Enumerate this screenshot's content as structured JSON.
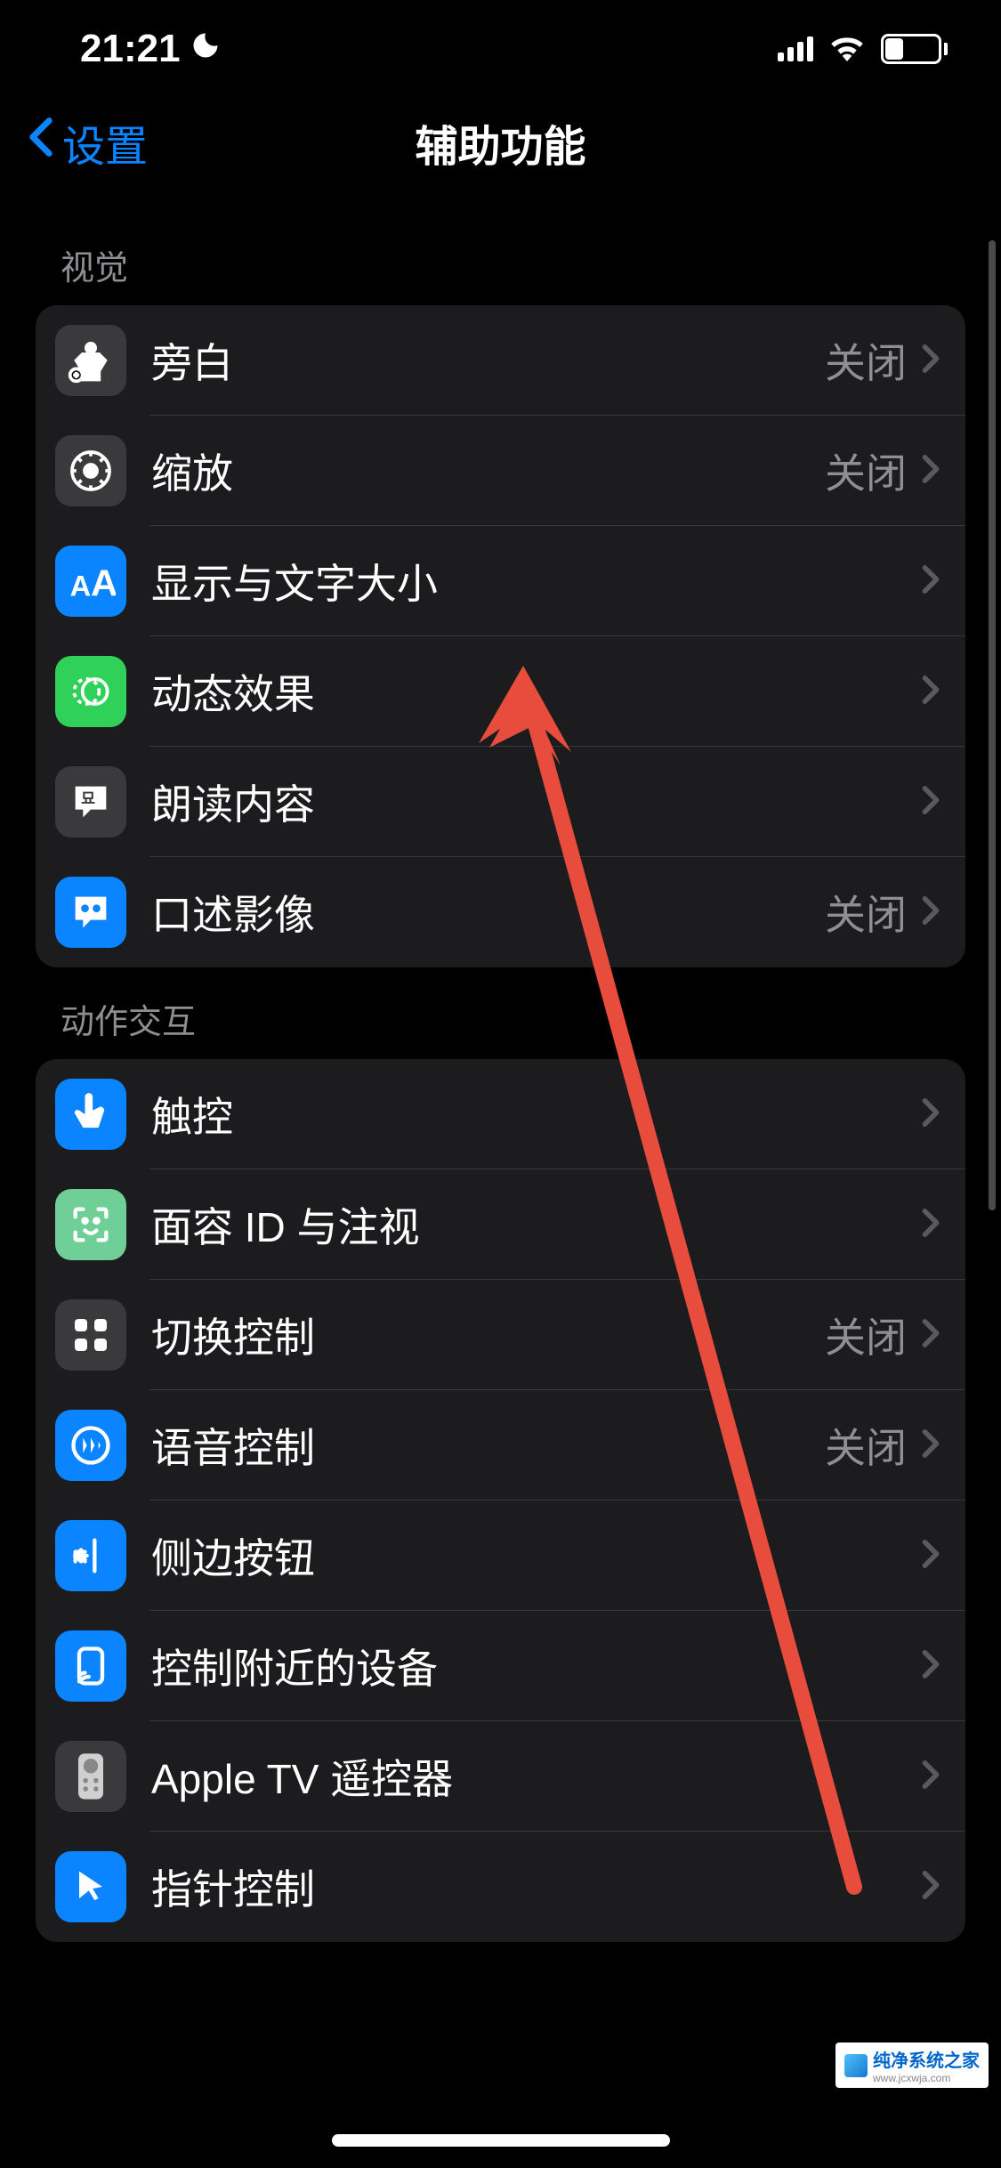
{
  "status": {
    "time": "21:21",
    "battery_percent": "33"
  },
  "nav": {
    "back_label": "设置",
    "title": "辅助功能"
  },
  "sections": [
    {
      "header": "视觉",
      "items": [
        {
          "icon": "voiceover-icon",
          "label": "旁白",
          "status": "关闭"
        },
        {
          "icon": "zoom-icon",
          "label": "缩放",
          "status": "关闭"
        },
        {
          "icon": "display-text-icon",
          "label": "显示与文字大小",
          "status": ""
        },
        {
          "icon": "motion-icon",
          "label": "动态效果",
          "status": ""
        },
        {
          "icon": "spoken-content-icon",
          "label": "朗读内容",
          "status": ""
        },
        {
          "icon": "audio-desc-icon",
          "label": "口述影像",
          "status": "关闭"
        }
      ]
    },
    {
      "header": "动作交互",
      "items": [
        {
          "icon": "touch-icon",
          "label": "触控",
          "status": ""
        },
        {
          "icon": "faceid-icon",
          "label": "面容 ID 与注视",
          "status": ""
        },
        {
          "icon": "switch-control-icon",
          "label": "切换控制",
          "status": "关闭"
        },
        {
          "icon": "voice-control-icon",
          "label": "语音控制",
          "status": "关闭"
        },
        {
          "icon": "side-button-icon",
          "label": "侧边按钮",
          "status": ""
        },
        {
          "icon": "nearby-device-icon",
          "label": "控制附近的设备",
          "status": ""
        },
        {
          "icon": "apple-tv-remote-icon",
          "label": "Apple TV 遥控器",
          "status": ""
        },
        {
          "icon": "pointer-control-icon",
          "label": "指针控制",
          "status": ""
        }
      ]
    }
  ],
  "watermark": {
    "title": "纯净系统之家",
    "url": "www.jcxwja.com"
  }
}
